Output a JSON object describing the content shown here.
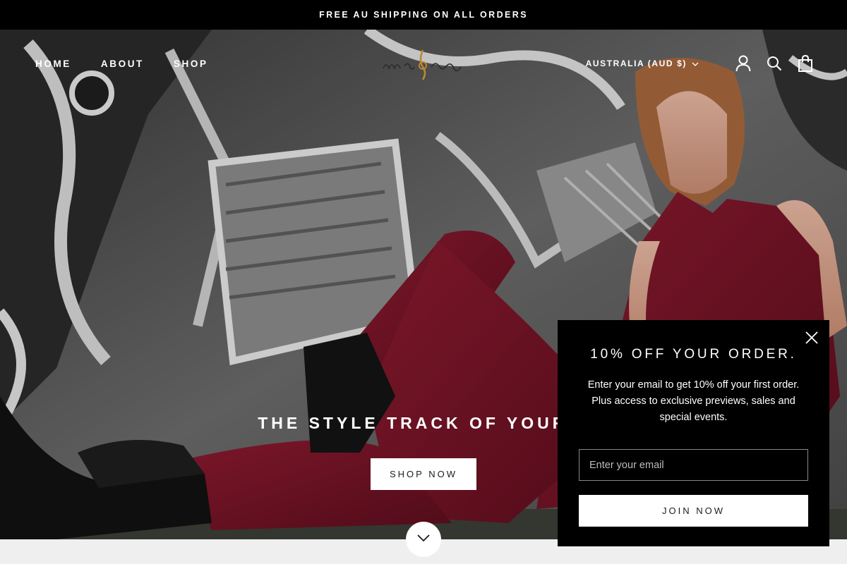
{
  "announcement": {
    "text": "FREE AU SHIPPING ON ALL ORDERS"
  },
  "nav": {
    "items": [
      {
        "label": "HOME"
      },
      {
        "label": "ABOUT"
      },
      {
        "label": "SHOP"
      }
    ]
  },
  "header": {
    "currency": "AUSTRALIA (AUD $)"
  },
  "icons": {
    "account": "user-icon",
    "search": "search-icon",
    "cart": "shopping-bag-icon",
    "close": "close-icon",
    "scroll": "chevron-down-icon"
  },
  "hero": {
    "title": "THE STYLE TRACK OF YOUR L",
    "button_label": "SHOP NOW"
  },
  "popup": {
    "title": "10% OFF YOUR ORDER.",
    "body": "Enter your email to get 10% off your first order. Plus access to exclusive previews, sales and special events.",
    "email_placeholder": "Enter your email",
    "button_label": "JOIN NOW"
  },
  "colors": {
    "accent": "#000000",
    "outfit": "#7a1428",
    "logo_gold": "#b8892f"
  }
}
